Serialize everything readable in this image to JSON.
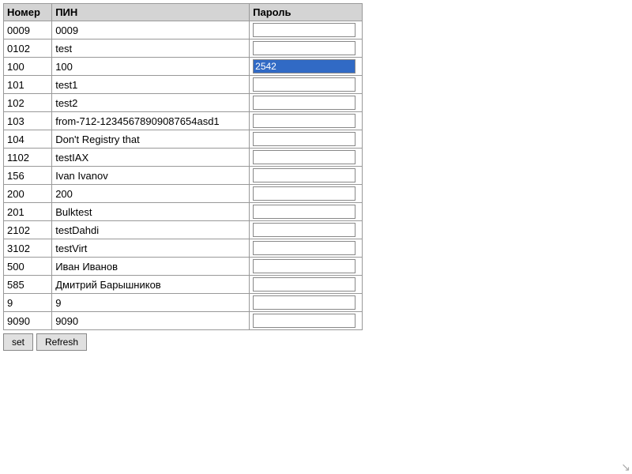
{
  "table": {
    "headers": {
      "number": "Номер",
      "name": "ПИН",
      "password": "Пароль"
    },
    "rows": [
      {
        "number": "0009",
        "name": "0009",
        "password": "",
        "highlighted": false
      },
      {
        "number": "0102",
        "name": "test",
        "password": "",
        "highlighted": false
      },
      {
        "number": "100",
        "name": "100",
        "password": "2542",
        "highlighted": true
      },
      {
        "number": "101",
        "name": "test1",
        "password": "",
        "highlighted": false
      },
      {
        "number": "102",
        "name": "test2",
        "password": "",
        "highlighted": false
      },
      {
        "number": "103",
        "name": "from-712-12345678909087654asd1",
        "password": "",
        "highlighted": false
      },
      {
        "number": "104",
        "name": "Don't Registry that",
        "password": "",
        "highlighted": false
      },
      {
        "number": "1102",
        "name": "testIAX",
        "password": "",
        "highlighted": false
      },
      {
        "number": "156",
        "name": "Ivan Ivanov",
        "password": "",
        "highlighted": false
      },
      {
        "number": "200",
        "name": "200",
        "password": "",
        "highlighted": false
      },
      {
        "number": "201",
        "name": "Bulktest",
        "password": "",
        "highlighted": false
      },
      {
        "number": "2102",
        "name": "testDahdi",
        "password": "",
        "highlighted": false
      },
      {
        "number": "3102",
        "name": "testVirt",
        "password": "",
        "highlighted": false
      },
      {
        "number": "500",
        "name": "Иван Иванов",
        "password": "",
        "highlighted": false
      },
      {
        "number": "585",
        "name": "Дмитрий Барышников",
        "password": "",
        "highlighted": false
      },
      {
        "number": "9",
        "name": "9",
        "password": "",
        "highlighted": false
      },
      {
        "number": "9090",
        "name": "9090",
        "password": "",
        "highlighted": false
      }
    ]
  },
  "buttons": {
    "set_label": "set",
    "refresh_label": "Refresh"
  }
}
